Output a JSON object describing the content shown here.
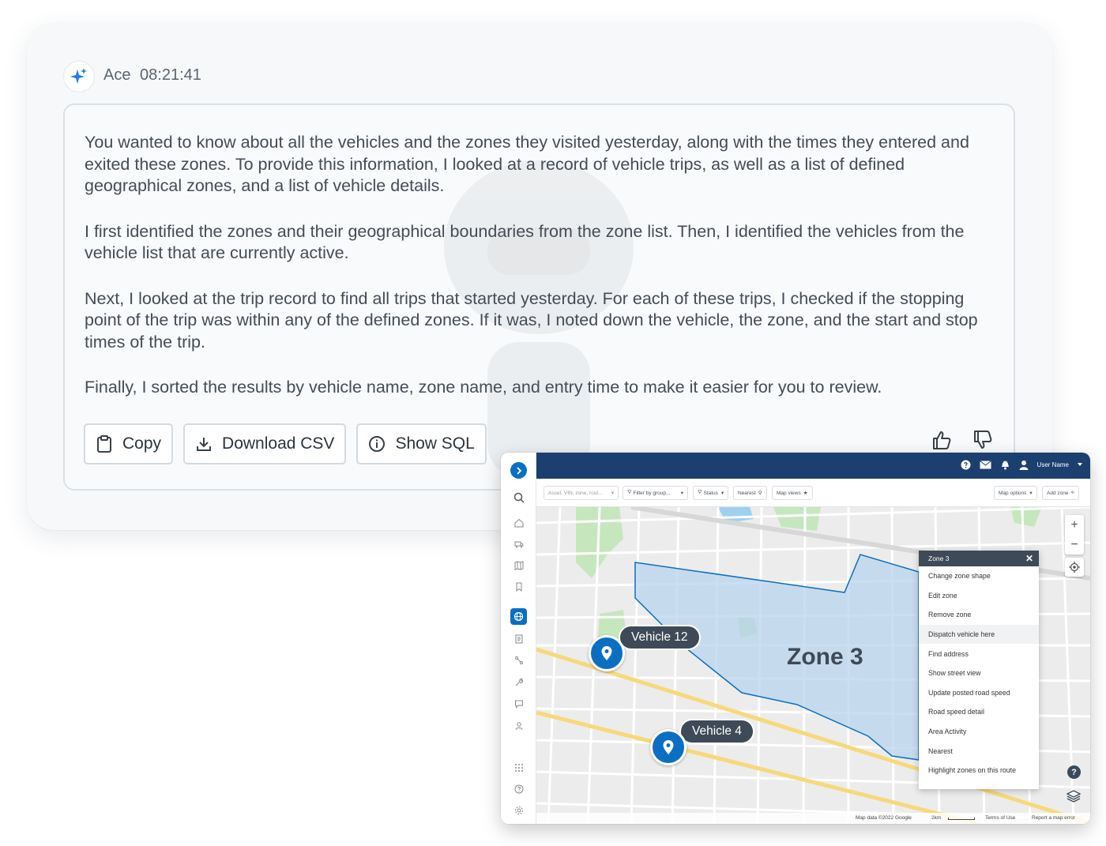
{
  "chat": {
    "sender": "Ace",
    "time": "08:21:41",
    "paragraphs": [
      "You wanted to know about all the vehicles and the zones they visited yesterday, along with the times they entered and exited these zones. To provide this information, I looked at a record of vehicle trips, as well as a list of defined geographical zones, and a list of vehicle details.",
      "I first identified the zones and their geographical boundaries from the zone list. Then, I identified the vehicles from the vehicle list that are currently active.",
      "Next, I looked at the trip record to find all trips that started yesterday. For each of these trips, I checked if the stopping point of the trip was within any of the defined zones. If it was, I noted down the vehicle, the zone, and the start and stop times of the trip.",
      "Finally, I sorted the results by vehicle name, zone name, and entry time to make it easier for you to review."
    ],
    "buttons": {
      "copy": "Copy",
      "download": "Download CSV",
      "sql": "Show SQL"
    },
    "feedback_icons": [
      "thumbs-up-icon",
      "thumbs-down-icon"
    ]
  },
  "map_app": {
    "top_bar": {
      "user_name": "User Name",
      "icons": [
        "help-icon",
        "mail-icon",
        "bell-icon",
        "user-icon"
      ]
    },
    "filters": {
      "search_placeholder": "Asset, VIN, zone, rout...",
      "filter_group": "Filter by group...",
      "status": "Status",
      "nearest": "Nearest",
      "map_views": "Map views",
      "map_options": "Map options",
      "add_zone": "Add zone"
    },
    "zone_label": "Zone 3",
    "vehicles": [
      {
        "label": "Vehicle 12"
      },
      {
        "label": "Vehicle 4"
      }
    ],
    "context_menu": {
      "title": "Zone 3",
      "items": [
        "Change zone shape",
        "Edit zone",
        "Remove zone",
        "Dispatch vehicle here",
        "Find address",
        "Show street view",
        "Update posted road speed",
        "Road speed detail",
        "Area Activity",
        "Nearest",
        "Highlight zones on this route"
      ],
      "highlighted_item": "Dispatch vehicle here"
    },
    "attribution": {
      "map_data": "Map data ©2022 Google",
      "scale": "2km",
      "terms": "Terms of Use",
      "report": "Report a map error"
    },
    "colors": {
      "brand_blue": "#0a6fc2",
      "top_bar": "#1b3f6e",
      "zone_fill": "#b9d4ef",
      "zone_stroke": "#0a6fc2"
    }
  }
}
